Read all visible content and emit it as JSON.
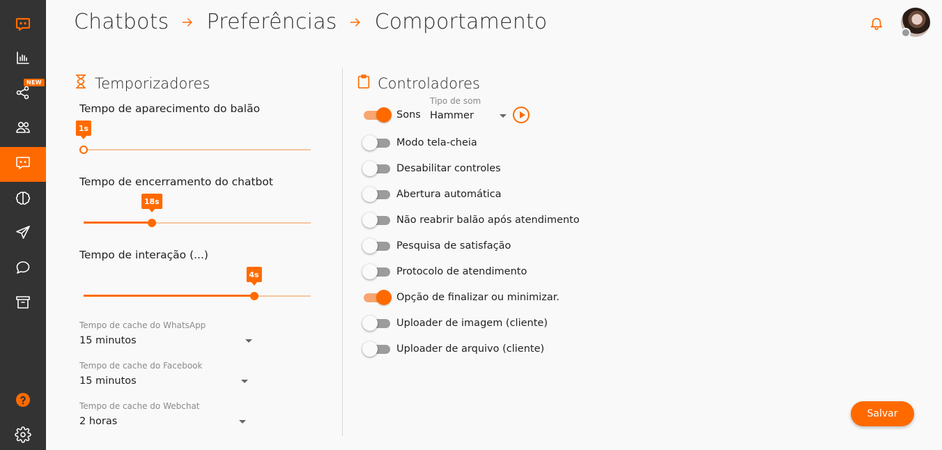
{
  "colors": {
    "accent": "#ff6a00",
    "sidebar": "#333333",
    "background": "#f9f9f9"
  },
  "sidebar": {
    "logo_icon": "chat-logo-icon",
    "new_badge": "NEW",
    "items": [
      {
        "icon": "bar-chart-icon",
        "active": false
      },
      {
        "icon": "share-icon",
        "active": false,
        "badge": "NEW"
      },
      {
        "icon": "users-icon",
        "active": false
      },
      {
        "icon": "chatbot-icon",
        "active": true
      },
      {
        "icon": "brain-icon",
        "active": false
      },
      {
        "icon": "send-icon",
        "active": false
      },
      {
        "icon": "chat-bubble-icon",
        "active": false
      },
      {
        "icon": "archive-icon",
        "active": false
      },
      {
        "icon": "help-icon",
        "active": false
      },
      {
        "icon": "settings-icon",
        "active": false
      }
    ]
  },
  "header": {
    "breadcrumb": [
      "Chatbots",
      "Preferências",
      "Comportamento"
    ]
  },
  "timers": {
    "title": "Temporizadores",
    "sliders": [
      {
        "label": "Tempo de aparecimento do balão",
        "value_label": "1s",
        "fraction": 0.0
      },
      {
        "label": "Tempo de encerramento do chatbot",
        "value_label": "18s",
        "fraction": 0.3
      },
      {
        "label": "Tempo de interação (...)",
        "value_label": "4s",
        "fraction": 0.75
      }
    ],
    "selects": [
      {
        "label": "Tempo de cache do WhatsApp",
        "value": "15 minutos"
      },
      {
        "label": "Tempo de cache do Facebook",
        "value": "15 minutos"
      },
      {
        "label": "Tempo de cache do Webchat",
        "value": "2 horas"
      }
    ]
  },
  "controllers": {
    "title": "Controladores",
    "sound_type_label": "Tipo de som",
    "sound_type_value": "Hammer",
    "toggles": [
      {
        "label": "Sons",
        "on": true
      },
      {
        "label": "Modo tela-cheia",
        "on": false
      },
      {
        "label": "Desabilitar controles",
        "on": false
      },
      {
        "label": "Abertura automática",
        "on": false
      },
      {
        "label": "Não reabrir balão após atendimento",
        "on": false
      },
      {
        "label": "Pesquisa de satisfação",
        "on": false
      },
      {
        "label": "Protocolo de atendimento",
        "on": false
      },
      {
        "label": "Opção de finalizar ou minimizar.",
        "on": true
      },
      {
        "label": "Uploader de imagem (cliente)",
        "on": false
      },
      {
        "label": "Uploader de arquivo (cliente)",
        "on": false
      }
    ]
  },
  "actions": {
    "save_label": "Salvar"
  }
}
